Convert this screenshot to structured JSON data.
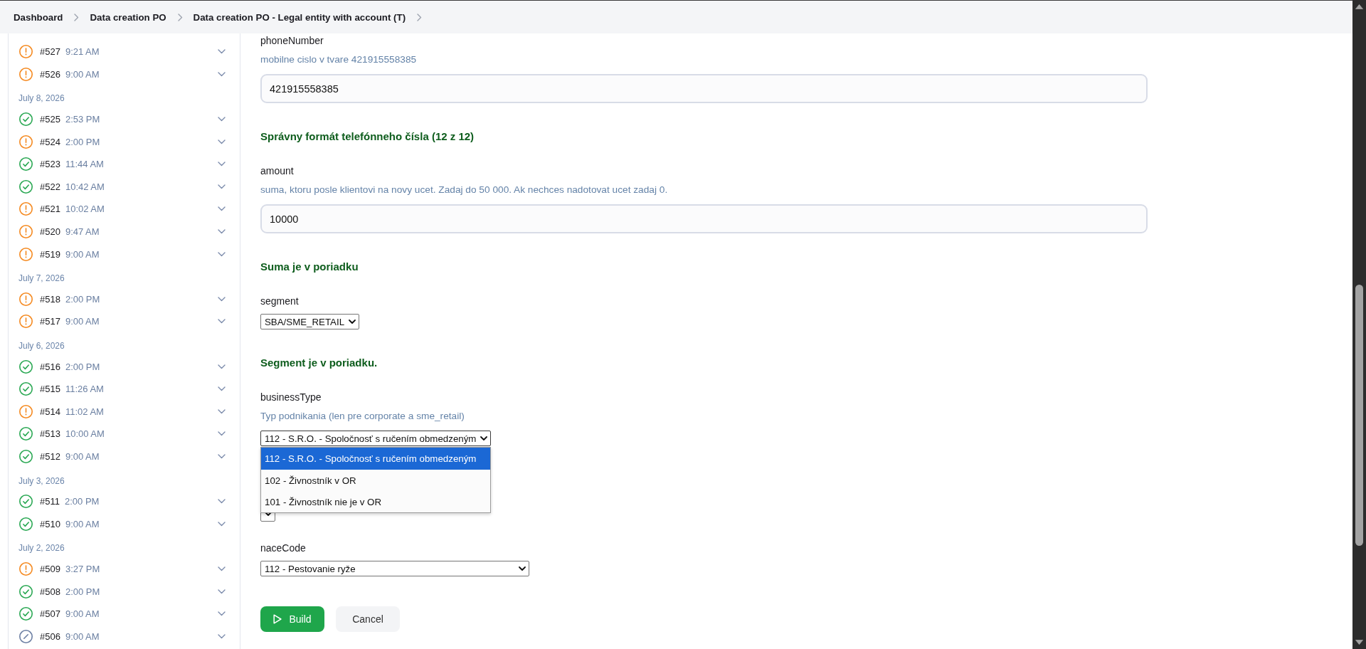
{
  "breadcrumb": [
    {
      "label": "Dashboard"
    },
    {
      "label": "Data creation PO"
    },
    {
      "label": "Data creation PO - Legal entity with account (T)"
    }
  ],
  "build_groups": [
    {
      "builds": [
        {
          "kind": "warning",
          "number": "#527",
          "time": "9:21 AM",
          "expanded": false
        },
        {
          "kind": "warning",
          "number": "#526",
          "time": "9:00 AM",
          "expanded": false
        }
      ]
    },
    {
      "date": "July 8, 2026",
      "builds": [
        {
          "kind": "success",
          "number": "#525",
          "time": "2:53 PM",
          "expanded": false
        },
        {
          "kind": "warning",
          "number": "#524",
          "time": "2:00 PM",
          "expanded": false
        },
        {
          "kind": "success",
          "number": "#523",
          "time": "11:44 AM",
          "expanded": false
        },
        {
          "kind": "success",
          "number": "#522",
          "time": "10:42 AM",
          "expanded": false
        },
        {
          "kind": "warning",
          "number": "#521",
          "time": "10:02 AM",
          "expanded": false
        },
        {
          "kind": "warning",
          "number": "#520",
          "time": "9:47 AM",
          "expanded": false
        },
        {
          "kind": "warning",
          "number": "#519",
          "time": "9:00 AM",
          "expanded": false
        }
      ]
    },
    {
      "date": "July 7, 2026",
      "builds": [
        {
          "kind": "warning",
          "number": "#518",
          "time": "2:00 PM",
          "expanded": false
        },
        {
          "kind": "warning",
          "number": "#517",
          "time": "9:00 AM",
          "expanded": false
        }
      ]
    },
    {
      "date": "July 6, 2026",
      "builds": [
        {
          "kind": "success",
          "number": "#516",
          "time": "2:00 PM",
          "expanded": false
        },
        {
          "kind": "success",
          "number": "#515",
          "time": "11:26 AM",
          "expanded": false
        },
        {
          "kind": "warning",
          "number": "#514",
          "time": "11:02 AM",
          "expanded": false
        },
        {
          "kind": "success",
          "number": "#513",
          "time": "10:00 AM",
          "expanded": false
        },
        {
          "kind": "success",
          "number": "#512",
          "time": "9:00 AM",
          "expanded": false
        }
      ]
    },
    {
      "date": "July 3, 2026",
      "builds": [
        {
          "kind": "success",
          "number": "#511",
          "time": "2:00 PM",
          "expanded": false
        },
        {
          "kind": "success",
          "number": "#510",
          "time": "9:00 AM",
          "expanded": false
        }
      ]
    },
    {
      "date": "July 2, 2026",
      "builds": [
        {
          "kind": "warning",
          "number": "#509",
          "time": "3:27 PM",
          "expanded": false
        },
        {
          "kind": "success",
          "number": "#508",
          "time": "2:00 PM",
          "expanded": false
        },
        {
          "kind": "success",
          "number": "#507",
          "time": "9:00 AM",
          "expanded": false
        },
        {
          "kind": "aborted",
          "number": "#506",
          "time": "9:00 AM",
          "expanded": false
        }
      ]
    }
  ],
  "form": {
    "fields": [
      {
        "kind": "text",
        "label": "phoneNumber",
        "description": "mobilne cislo v tvare 421915558385",
        "value": "421915558385",
        "message": "Správny formát telefónneho čísla (12 z 12)"
      },
      {
        "kind": "text",
        "label": "amount",
        "description": "suma, ktoru posle klientovi na novy ucet. Zadaj do 50 000. Ak nechces nadotovat ucet zadaj 0.",
        "value": "10000",
        "message": "Suma je v poriadku"
      },
      {
        "kind": "select",
        "label": "segment",
        "value": "SBA/SME_RETAIL",
        "expanded": false,
        "message": "Segment je v poriadku."
      },
      {
        "kind": "select",
        "label": "businessType",
        "description": "Typ podnikania (len pre corporate a sme_retail)",
        "value": "112 - S.R.O. - Spoločnosť s ručením obmedzeným",
        "expanded": true,
        "options": [
          {
            "label": "112 - S.R.O. - Spoločnosť s ručením obmedzeným",
            "selected": true
          },
          {
            "label": "102 - Živnostník v OR",
            "selected": false
          },
          {
            "label": "101 - Živnostník nie je v OR",
            "selected": false
          }
        ]
      },
      {
        "kind": "select",
        "expanded": false
      },
      {
        "kind": "select",
        "label": "naceCode",
        "value": "112 - Pestovanie ryže",
        "expanded": false
      }
    ],
    "buttons": [
      {
        "kind": "primary",
        "label": "Build"
      },
      {
        "kind": "secondary",
        "label": "Cancel"
      }
    ]
  }
}
